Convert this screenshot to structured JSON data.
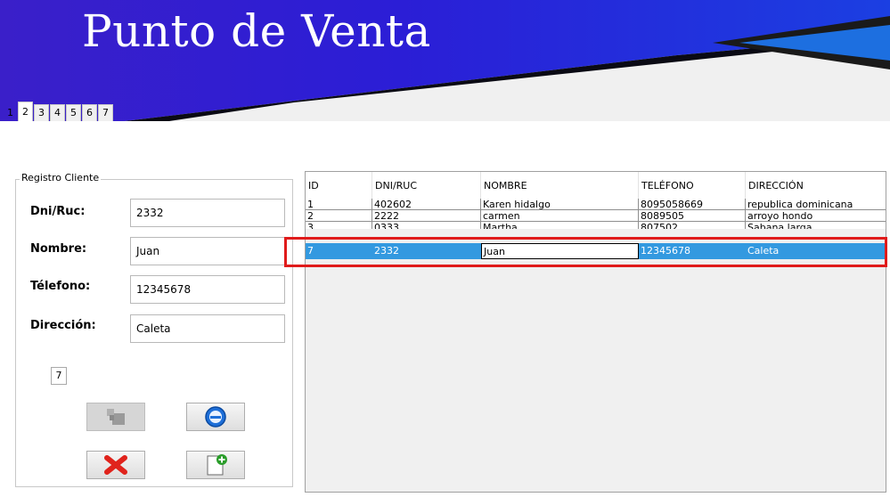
{
  "banner": {
    "title": "Punto de Venta"
  },
  "tabs": [
    {
      "label": "1",
      "active": false
    },
    {
      "label": "2",
      "active": true
    },
    {
      "label": "3",
      "active": false
    },
    {
      "label": "4",
      "active": false
    },
    {
      "label": "5",
      "active": false
    },
    {
      "label": "6",
      "active": false
    },
    {
      "label": "7",
      "active": false
    }
  ],
  "form": {
    "legend": "Registro Cliente",
    "dni_label": "Dni/Ruc:",
    "dni_value": "2332",
    "nombre_label": "Nombre:",
    "nombre_value": "Juan",
    "telefono_label": "Télefono:",
    "telefono_value": "12345678",
    "direccion_label": "Dirección:",
    "direccion_value": "Caleta",
    "id_value": "7"
  },
  "grid": {
    "columns": [
      "ID",
      "DNI/RUC",
      "NOMBRE",
      "TELÉFONO",
      "DIRECCIÓN"
    ],
    "rows": [
      [
        "1",
        "402602",
        "Karen hidalgo",
        "8095058669",
        "republica dominicana"
      ],
      [
        "2",
        "2222",
        "carmen",
        "8089505",
        "arroyo hondo"
      ],
      [
        "3",
        "0333",
        "Martha",
        "807502",
        "Sabana larga"
      ],
      [
        "7",
        "2332",
        "Juan",
        "12345678",
        "Caleta"
      ]
    ],
    "selected_row": 3
  },
  "colors": {
    "banner_blue": "#2a1fd0",
    "selection": "#3399e0",
    "highlight": "#e01b1b"
  },
  "icons": [
    "edit-user-icon",
    "search-icon",
    "delete-icon",
    "add-document-icon"
  ]
}
